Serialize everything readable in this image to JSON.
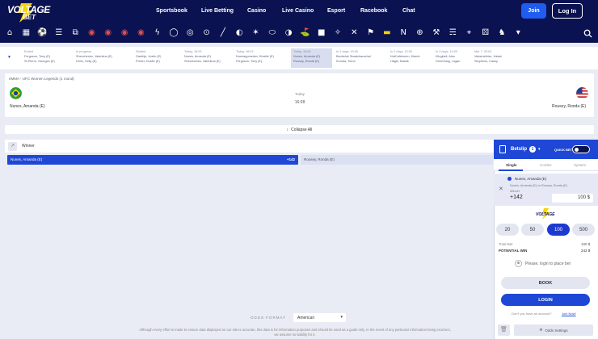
{
  "brand": {
    "line1": "VOLTAGE",
    "line2": "BET"
  },
  "nav": [
    "Sportsbook",
    "Live Betting",
    "Casino",
    "Live Casino",
    "Esport",
    "Racebook",
    "Chat"
  ],
  "auth": {
    "join": "Join",
    "login": "Log In"
  },
  "sports_icons": [
    "home-icon",
    "grid-icon",
    "soccer-icon",
    "list-icon",
    "copy-icon",
    "usa-flag-icon",
    "usa-flag-icon",
    "usa-flag-icon",
    "usa-flag-icon",
    "lightning-icon",
    "baseball-icon",
    "tennis-icon",
    "basketball-icon",
    "hockey-icon",
    "pingpong-icon",
    "badminton-icon",
    "rugby-icon",
    "volleyball-icon",
    "golf-icon",
    "boxing-icon",
    "mma-icon",
    "cricket-icon",
    "f1-icon",
    "mma-ufc-icon",
    "n-icon",
    "globe-icon",
    "esport-icon",
    "cycling-icon",
    "darts-icon",
    "dice-icon",
    "racing-icon",
    "chevron-down-icon"
  ],
  "events": [
    {
      "status": "Ended",
      "a": "Ferguson, Tony (E)",
      "b": "St-Pierre, Georges (E)"
    },
    {
      "status": "In progress",
      "a": "Shevchenko, Valentina (E)",
      "b": "Holm, Holly (E)"
    },
    {
      "status": "Started",
      "a": "Gaethje, Justin (E)",
      "b": "Poirier, Dustin (E)"
    },
    {
      "status": "Today, 16:03",
      "a": "Nunes, Amanda (E)",
      "b": "Shevchenko, Valentina (E)"
    },
    {
      "status": "Today, 16:03",
      "a": "Nurmagomedov, Khabib (E)",
      "b": "Ferguson, Tony (E)"
    },
    {
      "status": "Today, 16:08",
      "a": "Nunes, Amanda (E)",
      "b": "Rousey, Ronda (E)"
    },
    {
      "status": "In 2 days, 10:00",
      "a": "Banbeluk Siwatcharachai",
      "b": "Kuroda, Toma"
    },
    {
      "status": "In 2 days, 10:00",
      "a": "NutCafeboren, Klamb",
      "b": "Haghi, Babak"
    },
    {
      "status": "In 3 days, 10:00",
      "a": "Klingbeil, Alan",
      "b": "Greenhalg, Logan"
    },
    {
      "status": "Mar 7, 00:00",
      "a": "Vakamelidze, Kalani",
      "b": "Stephens, Casey"
    }
  ],
  "match": {
    "league": "eMMA - UFC Women Legends (1 round)",
    "home": "Nunes, Amanda (E)",
    "away": "Rousey, Ronda (E)",
    "day": "Today",
    "time": "16:08",
    "home_flag": "brazil",
    "away_flag": "usa"
  },
  "collapse": "Collapse All",
  "market": {
    "label": "Winner",
    "home": "Nunes, Amanda (E)",
    "home_odds": "+142",
    "away": "Rousey, Ronda (E)"
  },
  "betslip": {
    "title": "Betslip",
    "count": "1",
    "quick_bet": "QUICK BET",
    "tabs": [
      "Single",
      "Combo",
      "System"
    ],
    "selection": "Nunes, Amanda (E)",
    "matchup": "Nunes, Amanda (E) vs Rousey, Ronda (E)",
    "market": "Winner",
    "odds": "+142",
    "stake": "100 $",
    "chips": [
      "20",
      "50",
      "100",
      "500"
    ],
    "total_label": "Total Bet",
    "total_value": "100 $",
    "win_label": "POTENTIAL WIN",
    "win_value": "242 $",
    "login_prompt": "Please, login to place bet",
    "book": "BOOK",
    "login": "LOGIN",
    "no_account": "Don't you have an account?",
    "join_now": "Join Now!",
    "odds_settings": "Odds Settings"
  },
  "footer": {
    "odds_format_label": "ODDS FORMAT",
    "odds_format": "American",
    "disclaimer": "Although every effort is made to ensure data displayed on our site is accurate, this data is for information purposes and should be used as a guide only. In the event of any particular information being incorrect, we assume no liability for it."
  },
  "colors": {
    "navy": "#0b1251",
    "accent": "#1f47d6",
    "bg": "#e9ecf4"
  }
}
